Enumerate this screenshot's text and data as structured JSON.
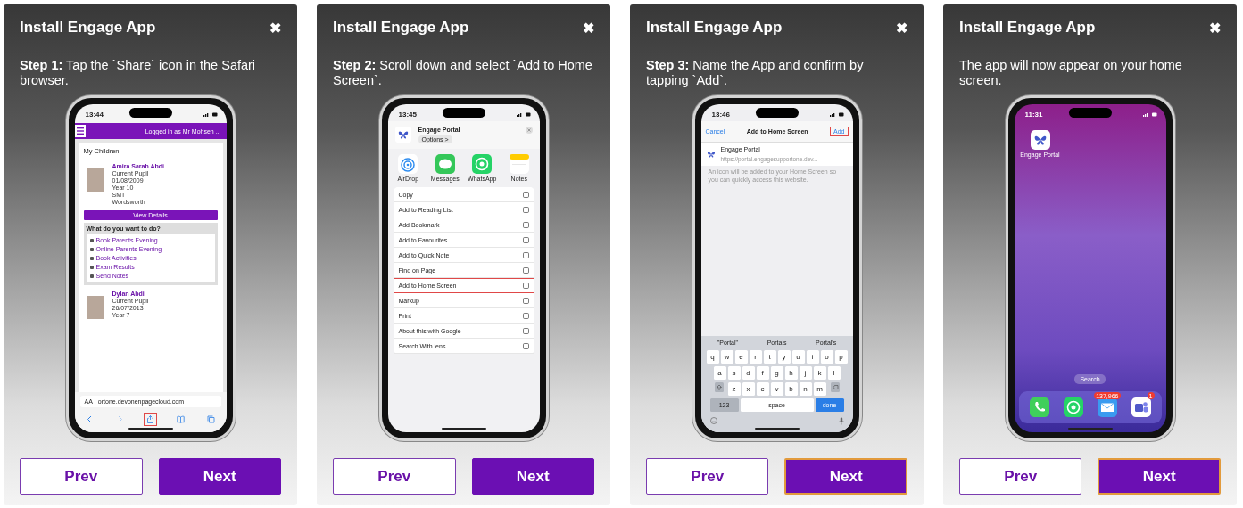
{
  "panels": [
    {
      "title": "Install Engage App",
      "close": "✖",
      "instruction": "**Step 1:** Tap the `Share` icon in the Safari browser.",
      "prev": {
        "label": "Prev"
      },
      "next": {
        "label": "Next",
        "focused": false
      },
      "phone": {
        "kind": "safari_page",
        "time": "13:44",
        "logged_in": "Logged in as Mr Mohsen ...",
        "heading": "My Children",
        "children": [
          {
            "name": "Amira Sarah Abdi",
            "lines": [
              "Current Pupil",
              "01/08/2009",
              "Year 10",
              "SMT",
              "Wordsworth"
            ]
          },
          {
            "name": "Dylan Abdi",
            "lines": [
              "Current Pupil",
              "26/07/2013",
              "Year 7"
            ]
          }
        ],
        "view_button": "View Details",
        "accordion": "What do you want to do?",
        "actions": [
          "Book Parents Evening",
          "Online Parents Evening",
          "Book Activities",
          "Exam Results",
          "Send Notes"
        ],
        "text_size": "AA",
        "url": "ortone.devonenpagecloud.com",
        "toolbar": [
          {
            "kind": "back",
            "highlighted": false
          },
          {
            "kind": "forward",
            "highlighted": false
          },
          {
            "kind": "share",
            "highlighted": true
          },
          {
            "kind": "bookmarks",
            "highlighted": false
          },
          {
            "kind": "tabs",
            "highlighted": false
          }
        ]
      }
    },
    {
      "title": "Install Engage App",
      "close": "✖",
      "instruction": "**Step 2:** Scroll down and select `Add to Home Screen`.",
      "prev": {
        "label": "Prev"
      },
      "next": {
        "label": "Next",
        "focused": false
      },
      "phone": {
        "kind": "share_sheet",
        "time": "13:45",
        "app_name": "Engage Portal",
        "options": "Options >",
        "apps": [
          {
            "kind": "airdrop",
            "label": "AirDrop"
          },
          {
            "kind": "messages",
            "label": "Messages"
          },
          {
            "kind": "whatsapp",
            "label": "WhatsApp"
          },
          {
            "kind": "notes",
            "label": "Notes"
          }
        ],
        "items": [
          {
            "label": "Copy",
            "highlighted": false
          },
          {
            "label": "Add to Reading List",
            "highlighted": false
          },
          {
            "label": "Add Bookmark",
            "highlighted": false
          },
          {
            "label": "Add to Favourites",
            "highlighted": false
          },
          {
            "label": "Add to Quick Note",
            "highlighted": false
          },
          {
            "label": "Find on Page",
            "highlighted": false
          },
          {
            "label": "Add to Home Screen",
            "highlighted": true
          },
          {
            "label": "Markup",
            "highlighted": false
          },
          {
            "label": "Print",
            "highlighted": false
          },
          {
            "label": "About this with Google",
            "highlighted": false
          },
          {
            "label": "Search With lens",
            "highlighted": false
          }
        ]
      }
    },
    {
      "title": "Install Engage App",
      "close": "✖",
      "instruction": "**Step 3:** Name the App and confirm by tapping `Add`.",
      "prev": {
        "label": "Prev"
      },
      "next": {
        "label": "Next",
        "focused": true
      },
      "phone": {
        "kind": "add_home",
        "time": "13:46",
        "cancel": "Cancel",
        "nav_title": "Add to Home Screen",
        "add": {
          "label": "Add",
          "highlighted": true
        },
        "app_name": "Engage Portal",
        "url": "https://portal.engagesupportone.dev...",
        "note": "An icon will be added to your Home Screen so you can quickly access this website.",
        "suggestions": [
          "\"Portal\"",
          "Portals",
          "Portal's"
        ],
        "key_rows": [
          [
            "q",
            "w",
            "e",
            "r",
            "t",
            "y",
            "u",
            "i",
            "o",
            "p"
          ],
          [
            "a",
            "s",
            "d",
            "f",
            "g",
            "h",
            "j",
            "k",
            "l"
          ],
          [
            "z",
            "x",
            "c",
            "v",
            "b",
            "n",
            "m"
          ]
        ],
        "bottom_keys": [
          "123",
          "space",
          "done"
        ]
      }
    },
    {
      "title": "Install Engage App",
      "close": "✖",
      "instruction": "The app will now appear on your home screen.",
      "prev": {
        "label": "Prev"
      },
      "next": {
        "label": "Next",
        "focused": true
      },
      "phone": {
        "kind": "home_screen",
        "time": "11:31",
        "app_label": "Engage Portal",
        "search": "Search",
        "dock": [
          {
            "kind": "phone"
          },
          {
            "kind": "whatsapp"
          },
          {
            "kind": "mail",
            "badge": "137,966"
          },
          {
            "kind": "teams",
            "badge": "1"
          }
        ]
      }
    }
  ]
}
